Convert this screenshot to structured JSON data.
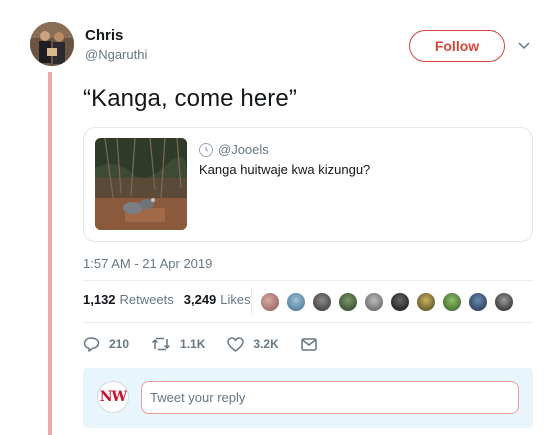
{
  "author": {
    "display_name": "Chris",
    "handle": "@Ngaruthi"
  },
  "follow_label": "Follow",
  "tweet_text": "“Kanga, come here”",
  "quoted": {
    "handle": "@Jooels",
    "text": "Kanga huitwaje kwa kizungu?"
  },
  "timestamp": "1:57 AM - 21 Apr 2019",
  "stats": {
    "retweets_count": "1,132",
    "retweets_label": "Retweets",
    "likes_count": "3,249",
    "likes_label": "Likes"
  },
  "actions": {
    "reply_count": "210",
    "retweet_count": "1.1K",
    "like_count": "3.2K"
  },
  "reply": {
    "avatar_text": "NW",
    "placeholder": "Tweet your reply"
  },
  "colors": {
    "accent": "#d9453a",
    "thread_line": "#eba9a9",
    "secondary_text": "#657786",
    "reply_bg": "#e8f5fd"
  }
}
